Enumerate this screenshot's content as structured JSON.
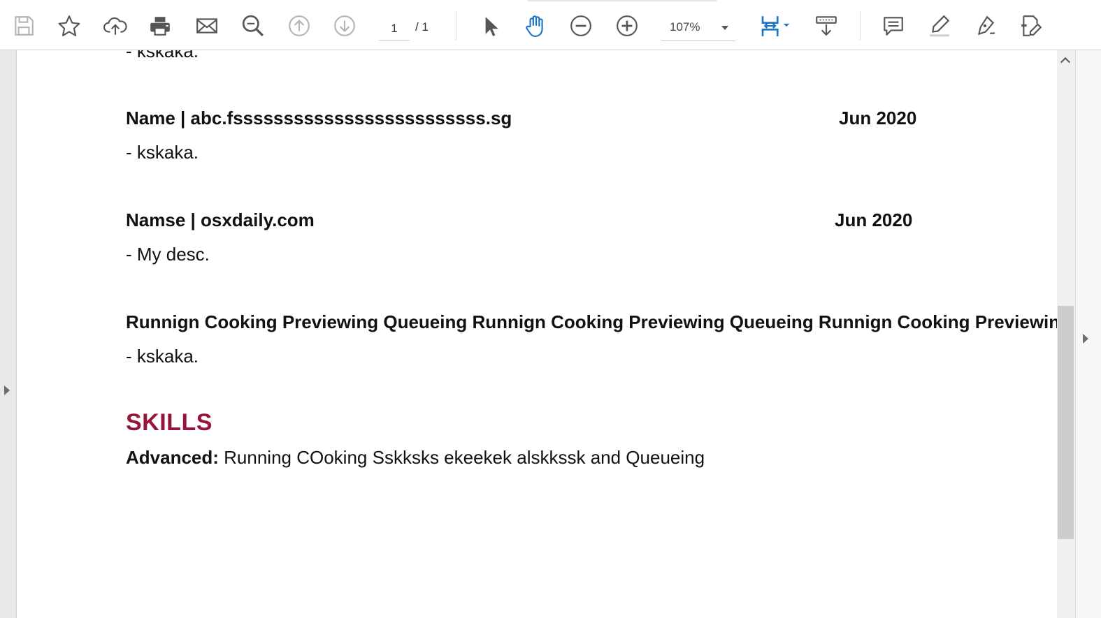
{
  "toolbar": {
    "page_current": "1",
    "page_total": "/ 1",
    "zoom": "107%",
    "icons": [
      "save-icon",
      "bookmark-star-icon",
      "upload-cloud-icon",
      "print-icon",
      "email-icon",
      "zoom-search-icon",
      "page-up-icon",
      "page-down-icon",
      "select-cursor-icon",
      "hand-tool-icon",
      "zoom-out-icon",
      "zoom-in-icon",
      "fit-page-icon",
      "scroll-mode-icon",
      "comment-icon",
      "highlight-icon",
      "draw-icon",
      "fill-sign-icon"
    ],
    "accent_color": "#1a73c8"
  },
  "document": {
    "partial_top_line": "- kskaka.",
    "entries": [
      {
        "title": "Name | abc.fsssssssssssssssssssssssss.sg",
        "date": "Jun 2020",
        "desc": "- kskaka."
      },
      {
        "title": "Namse | osxdaily.com",
        "date": "Jun 2020",
        "desc": "- My desc."
      },
      {
        "title": "Runnign Cooking Previewing Queueing Runnign Cooking Previewing Queueing Runnign Cooking Previewing Queueing",
        "date": "",
        "desc": "- kskaka."
      }
    ],
    "skills_heading": "SKILLS",
    "skills_color": "#96163a",
    "skills_label": "Advanced:",
    "skills_text": " Running COoking Sskksks ekeekek alskkssk and Queueing"
  }
}
